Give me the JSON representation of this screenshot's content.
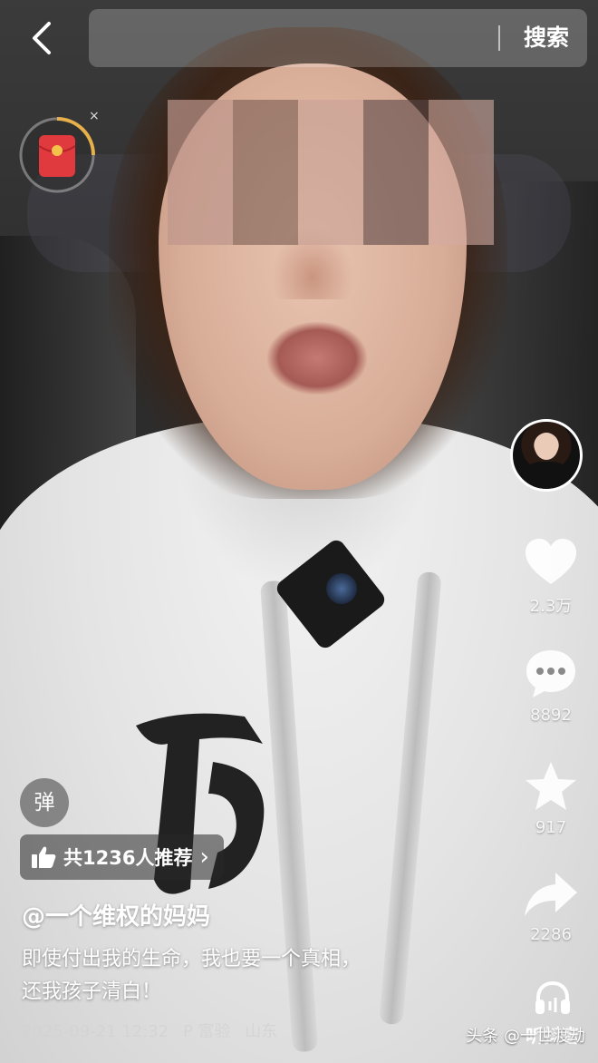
{
  "search": {
    "placeholder": "",
    "button_label": "搜索"
  },
  "red_packet": {
    "close_label": "×"
  },
  "danmu": {
    "label": "弹"
  },
  "recommend": {
    "label": "共1236人推荐",
    "chevron": "›"
  },
  "sidebar": {
    "likes": "2.3万",
    "comments": "8892",
    "favorites": "917",
    "shares": "2286",
    "listen_label": "听抖音"
  },
  "post": {
    "author": "@一个维权的妈妈",
    "description_line1": "即使付出我的生命，我也要一个真相，",
    "description_line2": "还我孩子清白！",
    "datetime": "2025-09-21 12:32",
    "location": "P 富验",
    "region": "山东"
  },
  "watermark": "头条 @一世渡劫",
  "colors": {
    "red_packet": "#e0393e",
    "accent_gold": "#e8b04a",
    "overlay_text": "#ffffff"
  },
  "icons": {
    "back": "chevron-left-icon",
    "like": "heart-icon",
    "comment": "comment-bubble-icon",
    "favorite": "star-icon",
    "share": "share-arrow-icon",
    "listen": "headphones-icon",
    "recommend": "thumbs-up-icon"
  }
}
